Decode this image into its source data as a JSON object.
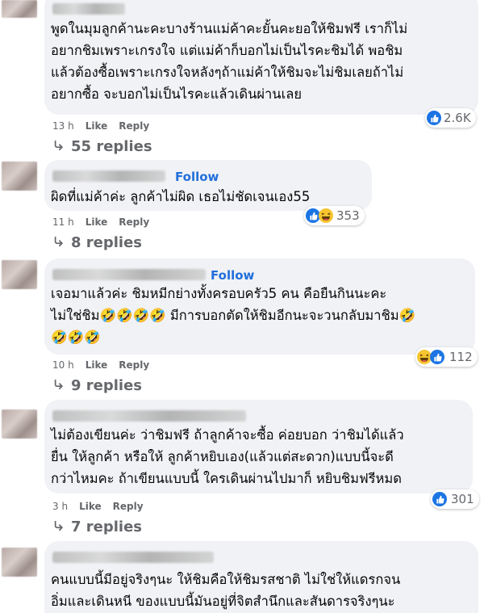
{
  "comments": [
    {
      "follow": "",
      "text": "พูดในมุมลูกค้านะคะบางร้านแม่ค้าคะยั้นคะยอให้ชิมฟรี เราก็ไม่\nอยากชิมเพราะเกรงใจ แต่แม่ค้าก็บอกไม่เป็นไรคะชิมได้ พอชิม\nแล้วต้องซื้อเพราะเกรงใจหลังๆถ้าแม่ค้าให้ชิมจะไม่ชิมเลยถ้าไม่\nอยากซื้อ จะบอกไม่เป็นไรคะแล้วเดินผ่านเลย",
      "time": "13 h",
      "like": "Like",
      "reply": "Reply",
      "reaction_count": "2.6K",
      "reactions": [
        "like-icon"
      ],
      "replies": "55 replies"
    },
    {
      "follow": "Follow",
      "text": "ผิดที่แม่ค้าค่ะ ลูกค้าไม่ผิด เธอไม่ชัดเจนเอง55",
      "time": "11 h",
      "like": "Like",
      "reply": "Reply",
      "reaction_count": "353",
      "reactions": [
        "like-icon",
        "haha-icon"
      ],
      "replies": "8 replies"
    },
    {
      "follow": "Follow",
      "text": "เจอมาแล้วค่ะ ชิมหมีกย่างทั้งครอบครัว5 คน คือยืนกินนะคะ\nไม่ใช่ชิม🤣🤣🤣🤣 มีการบอกตัดให้ชิมอีกนะจะวนกลับมาชิม🤣\n🤣🤣🤣",
      "time": "10 h",
      "like": "Like",
      "reply": "Reply",
      "reaction_count": "112",
      "reactions": [
        "haha-icon",
        "like-icon"
      ],
      "replies": "9 replies"
    },
    {
      "follow": "",
      "text": "ไม่ต้องเขียนค่ะ ว่าชิมฟรี ถ้าลูกค้าจะซื้อ ค่อยบอก ว่าชิมได้แล้ว\nยื่น ให้ลูกค้า หรือให้ ลูกค้าหยิบเอง(แล้วแต่สะดวก)แบบนี้จะดี\nกว่าไหมคะ ถ้าเขียนแบบนี้ ใครเดินผ่านไปมาก็ หยิบชิมฟรีหมด",
      "time": "3 h",
      "like": "Like",
      "reply": "Reply",
      "reaction_count": "301",
      "reactions": [
        "like-icon"
      ],
      "replies": "7 replies"
    },
    {
      "follow": "",
      "text": "คนแบบนี้มีอยู่จริงๆนะ ให้ชิมคือให้ชิมรสชาติ ไม่ใช่ให้แดรกจน\nอิ่มและเดินหนี ของแบบนี้มันอยู่ที่จิตสำนึกและสันดารจริงๆนะ",
      "time": "",
      "like": "",
      "reply": "",
      "reaction_count": "",
      "reactions": [],
      "replies": ""
    }
  ],
  "colors": {
    "bubble": "#f0f2f5",
    "follow": "#216fdb",
    "meta": "#65676b",
    "like": "#1b74e4"
  }
}
